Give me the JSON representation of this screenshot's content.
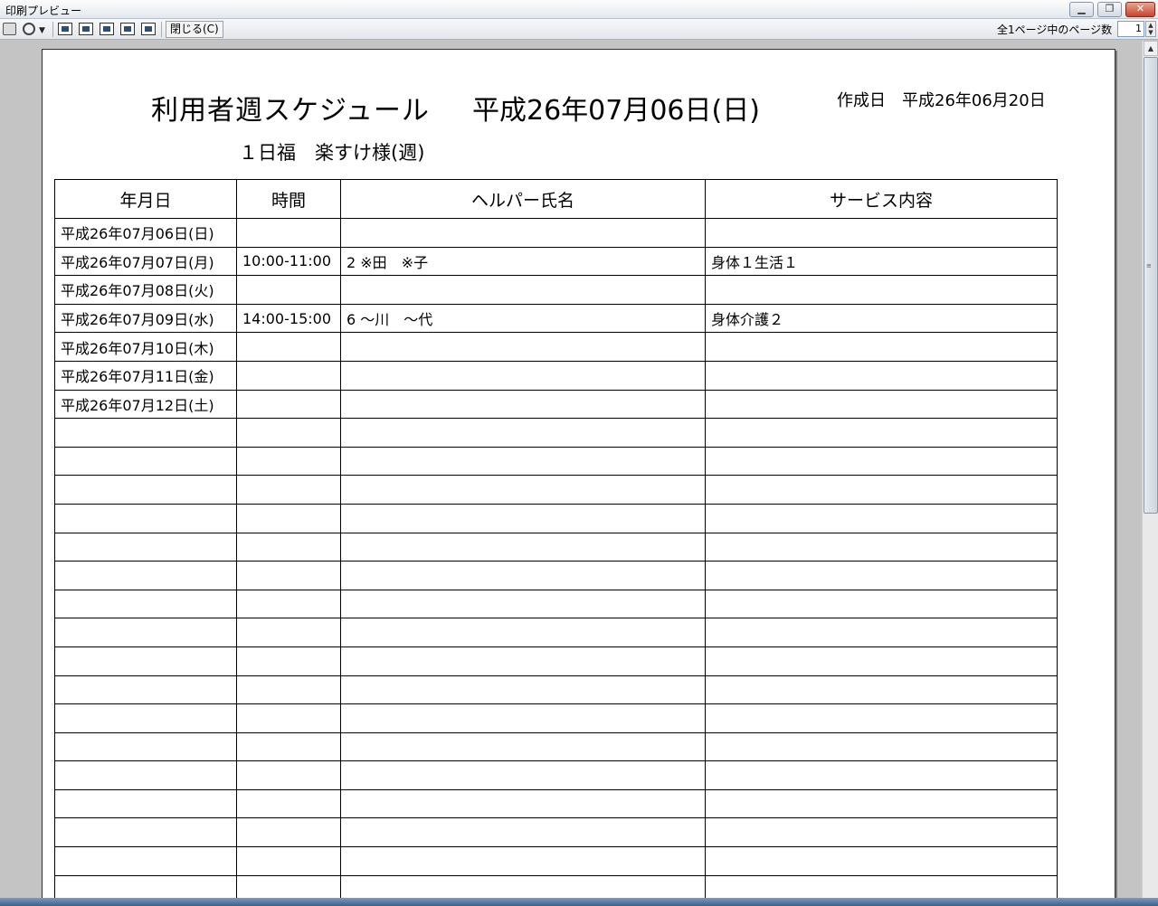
{
  "window": {
    "title": "印刷プレビュー",
    "close_label": "閉じる(C)",
    "page_count_label": "全1ページ中のページ数",
    "page_number": "1"
  },
  "report": {
    "title": "利用者週スケジュール",
    "week_date": "平成26年07月06日(日)",
    "created": "作成日　平成26年06月20日",
    "client": "１日福　楽すけ様(週)",
    "headers": [
      "年月日",
      "時間",
      "ヘルパー氏名",
      "サービス内容"
    ],
    "rows": [
      [
        "平成26年07月06日(日)",
        "",
        "",
        ""
      ],
      [
        "平成26年07月07日(月)",
        "10:00-11:00",
        "2 ※田　※子",
        "身体１生活１"
      ],
      [
        "平成26年07月08日(火)",
        "",
        "",
        ""
      ],
      [
        "平成26年07月09日(水)",
        "14:00-15:00",
        "6 ～川　～代",
        "身体介護２"
      ],
      [
        "平成26年07月10日(木)",
        "",
        "",
        ""
      ],
      [
        "平成26年07月11日(金)",
        "",
        "",
        ""
      ],
      [
        "平成26年07月12日(土)",
        "",
        "",
        ""
      ],
      [
        "",
        "",
        "",
        ""
      ],
      [
        "",
        "",
        "",
        ""
      ],
      [
        "",
        "",
        "",
        ""
      ],
      [
        "",
        "",
        "",
        ""
      ],
      [
        "",
        "",
        "",
        ""
      ],
      [
        "",
        "",
        "",
        ""
      ],
      [
        "",
        "",
        "",
        ""
      ],
      [
        "",
        "",
        "",
        ""
      ],
      [
        "",
        "",
        "",
        ""
      ],
      [
        "",
        "",
        "",
        ""
      ],
      [
        "",
        "",
        "",
        ""
      ],
      [
        "",
        "",
        "",
        ""
      ],
      [
        "",
        "",
        "",
        ""
      ],
      [
        "",
        "",
        "",
        ""
      ],
      [
        "",
        "",
        "",
        ""
      ],
      [
        "",
        "",
        "",
        ""
      ],
      [
        "",
        "",
        "",
        ""
      ]
    ]
  }
}
